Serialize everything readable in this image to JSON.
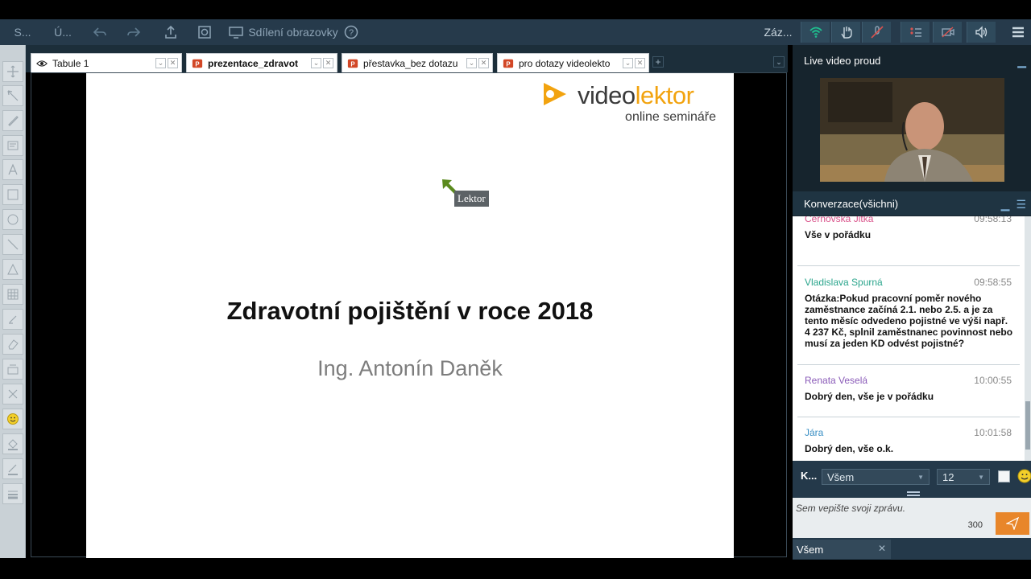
{
  "toolbar": {
    "left": [
      {
        "label": "S...",
        "name": "menu-s"
      },
      {
        "label": "Ú...",
        "name": "menu-u"
      }
    ],
    "screen_share_label": "Sdílení obrazovky",
    "record_label": "Záz...",
    "accent": "#1fbf8f"
  },
  "tabs": [
    {
      "label": "Tabule 1",
      "icon": "eye-icon"
    },
    {
      "label": "prezentace_zdravot",
      "icon": "powerpoint-icon",
      "active": true
    },
    {
      "label": "přestavka_bez dotazu",
      "icon": "powerpoint-icon"
    },
    {
      "label": "pro dotazy videolekto",
      "icon": "powerpoint-icon"
    }
  ],
  "slide": {
    "logo_main": "video",
    "logo_accent": "lektor",
    "logo_sub": "online semináře",
    "title": "Zdravotní pojištění v roce 2018",
    "subtitle": "Ing. Antonín Daněk",
    "pointer_label": "Lektor"
  },
  "video_panel": {
    "title": "Live video proud"
  },
  "chat_panel": {
    "title": "Konverzace(všichni)",
    "messages": [
      {
        "name": "Černovská Jitka",
        "time": "09:58:13",
        "text": "Vše v pořádku",
        "color": "#d9528a"
      },
      {
        "name": "Vladislava Spurná",
        "time": "09:58:55",
        "text": "Otázka:Pokud pracovní poměr nového zaměstnance začíná 2.1. nebo 2.5. a je za tento měsíc odvedeno  pojistné ve výši např. 4 237 Kč, splnil zaměstnanec povinnost nebo musí za jeden KD odvést pojistné?",
        "color": "#2aa58c"
      },
      {
        "name": "Renata Veselá",
        "time": "10:00:55",
        "text": "Dobrý den, vše je v pořádku",
        "color": "#8a5bb8"
      },
      {
        "name": "Jára",
        "time": "10:01:58",
        "text": "Dobrý den, vše o.k.",
        "color": "#3a8fc4"
      }
    ]
  },
  "composer": {
    "k_label": "K...",
    "recipient": "Všem",
    "font_size": "12",
    "placeholder": "Sem vepište svoji zprávu.",
    "char_count": "300",
    "recipient_tab": "Všem"
  }
}
